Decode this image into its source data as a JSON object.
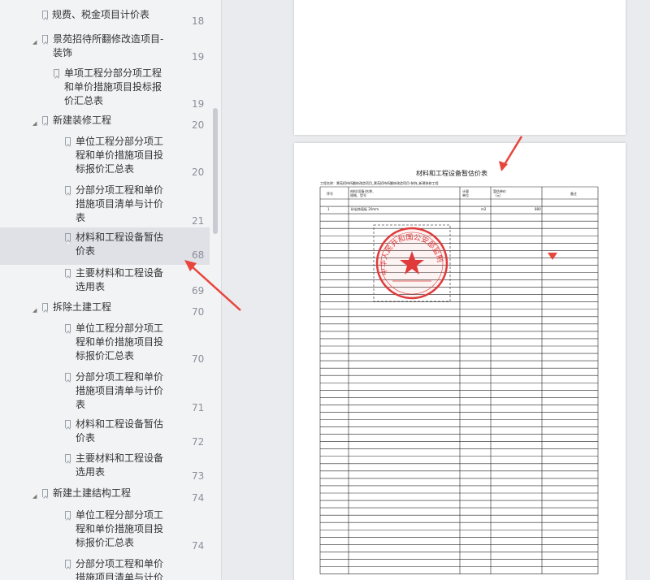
{
  "bookmarks": [
    {
      "title": "规费、税金项目计价表",
      "page": "18"
    },
    {
      "title": "景苑招待所翻修改造项目-装饰",
      "page": "19"
    },
    {
      "title": "单项工程分部分项工程和单价措施项目投标报价汇总表",
      "page": "19"
    },
    {
      "title": "新建装修工程",
      "page": "20"
    },
    {
      "title": "单位工程分部分项工程和单价措施项目投标报价汇总表",
      "page": "20"
    },
    {
      "title": "分部分项工程和单价措施项目清单与计价表",
      "page": "21"
    },
    {
      "title": "材料和工程设备暂估价表",
      "page": "68"
    },
    {
      "title": "主要材料和工程设备选用表",
      "page": "69"
    },
    {
      "title": "拆除土建工程",
      "page": "70"
    },
    {
      "title": "单位工程分部分项工程和单价措施项目投标报价汇总表",
      "page": "70"
    },
    {
      "title": "分部分项工程和单价措施项目清单与计价表",
      "page": "71"
    },
    {
      "title": "材料和工程设备暂估价表",
      "page": "72"
    },
    {
      "title": "主要材料和工程设备选用表",
      "page": "73"
    },
    {
      "title": "新建土建结构工程",
      "page": "74"
    },
    {
      "title": "单位工程分部分项工程和单价措施项目投标报价汇总表",
      "page": "74"
    },
    {
      "title": "分部分项工程和单价措施项目清单与计价表",
      "page": ""
    }
  ],
  "bookmark_lines": [
    [
      "规费、税金项目计价表"
    ],
    [
      "景苑招待所翻修改造项目-",
      "装饰"
    ],
    [
      "单项工程分部分项工程",
      "和单价措施项目投标报",
      "价汇总表"
    ],
    [
      "新建装修工程"
    ],
    [
      "单位工程分部分项工",
      "程和单价措施项目投",
      "标报价汇总表"
    ],
    [
      "分部分项工程和单价",
      "措施项目清单与计价",
      "表"
    ],
    [
      "材料和工程设备暂估",
      "价表"
    ],
    [
      "主要材料和工程设备",
      "选用表"
    ],
    [
      "拆除土建工程"
    ],
    [
      "单位工程分部分项工",
      "程和单价措施项目投",
      "标报价汇总表"
    ],
    [
      "分部分项工程和单价",
      "措施项目清单与计价",
      "表"
    ],
    [
      "材料和工程设备暂估",
      "价表"
    ],
    [
      "主要材料和工程设备",
      "选用表"
    ],
    [
      "新建土建结构工程"
    ],
    [
      "单位工程分部分项工",
      "程和单价措施项目投",
      "标报价汇总表"
    ],
    [
      "分部分项工程和单价",
      "措施项目清单与计价"
    ]
  ],
  "document": {
    "title": "材料和工程设备暂估价表",
    "project": "工程名称：景苑招待所翻修改造项目_景苑招待所翻修改造项目-装饰_新建装修工程",
    "headers": {
      "no": "序号",
      "name_l1": "材料(设备)名称、",
      "name_l2": "规格、型号",
      "unit_l1": "计量",
      "unit_l2": "单位",
      "price_l1": "暂估单价",
      "price_l2": "（元）",
      "remark": "备注"
    },
    "row1": {
      "no": "1",
      "name": "砂岩饰面板 20mm",
      "unit": "m2",
      "price": "880"
    }
  },
  "seal": {
    "text": "中华人民共和国公安部监制",
    "color": "#e03a3a"
  },
  "annotation_color": "#e8453c"
}
